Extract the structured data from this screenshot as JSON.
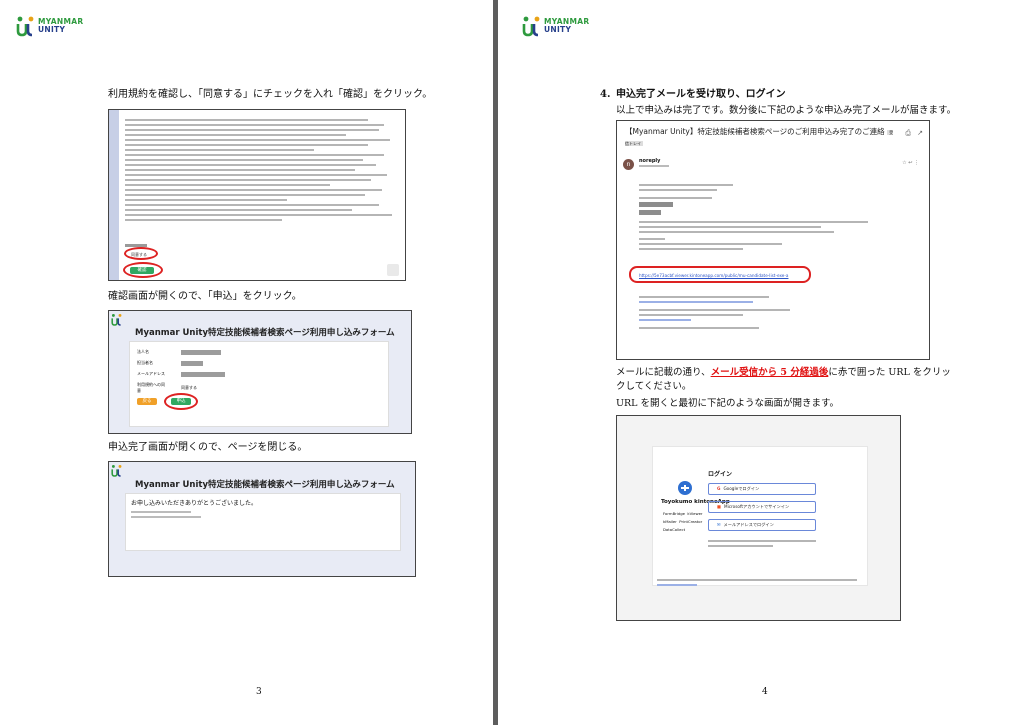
{
  "logo": {
    "line1": "MYANMAR",
    "line2": "UNITY"
  },
  "page3": {
    "intro": "利用規約を確認し、「同意する」にチェックを入れ「確認」をクリック。",
    "terms_shot": {
      "agree_label": "同意する",
      "confirm_label": "確認"
    },
    "step2": "確認画面が開くので、「申込」をクリック。",
    "form_shot": {
      "title": "Myanmar Unity特定技能候補者検索ページ利用申し込みフォーム",
      "rows": [
        "法人名",
        "担当者名",
        "メールアドレス",
        "利用規約への同意"
      ],
      "agree_value": "同意する",
      "back_label": "戻る",
      "apply_label": "申込"
    },
    "step3": "申込完了画面が閉くので、ページを閉じる。",
    "done_shot": {
      "title": "Myanmar Unity特定技能候補者検索ページ利用申し込みフォーム",
      "message": "お申し込みいただきありがとうございました。"
    },
    "page_number": "3"
  },
  "page4": {
    "heading_num": "4.",
    "heading": "申込完了メールを受け取り、ログイン",
    "intro": "以上で申込みは完了です。数分後に下記のような申込み完了メールが届きます。",
    "email_shot": {
      "subject": "【Myanmar Unity】特定技能候補者検索ページのご利用申込み完了のご連絡",
      "tag": "受信トレイ",
      "sender": "noreply",
      "avatar": "n",
      "link": "https://5e73acbf.viewer.kintoneapp.com/public/mu-candidate-list-exe-a"
    },
    "para_pre": "メールに記載の通り、",
    "para_red": "メール受信から 5 分経過後",
    "para_post": "に赤で囲った URL をクリックしてください。",
    "para2": "URL を開くと最初に下記のような画面が開きます。",
    "login_shot": {
      "brand": "Toyokumo kintoneApp",
      "products": [
        "FormBridge",
        "kViewer",
        "kMailer",
        "PrintCreator",
        "DataCollect"
      ],
      "title": "ログイン",
      "buttons": [
        "Googleでログイン",
        "Microsoftアカウントでサインイン",
        "メールアドレスでログイン"
      ]
    },
    "page_number": "4"
  }
}
